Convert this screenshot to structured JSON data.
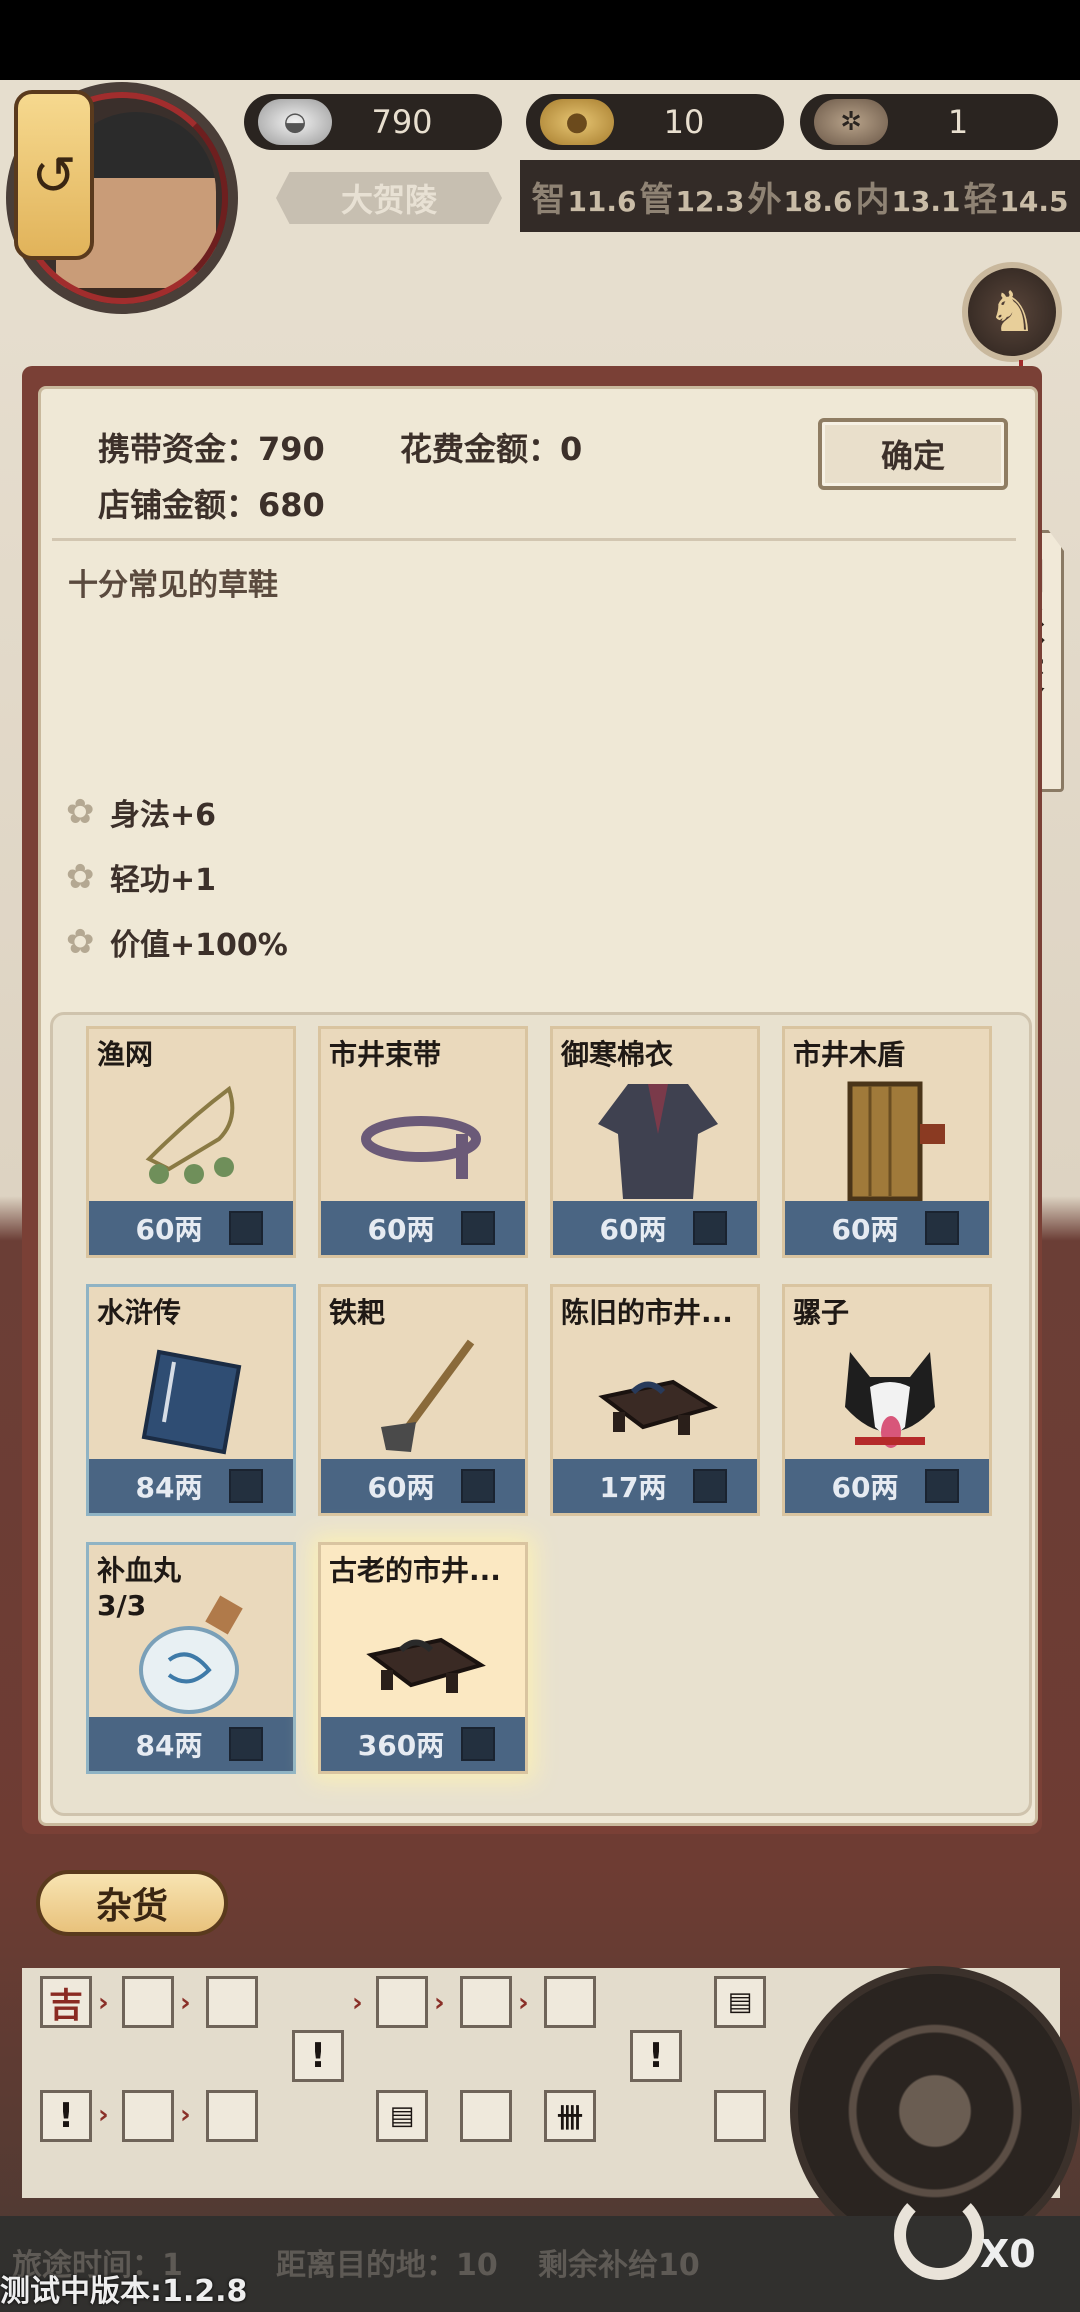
{
  "resources": {
    "silver": "790",
    "coins": "10",
    "wheel": "1"
  },
  "location": "大贺陵",
  "attributes": [
    {
      "icon": "智",
      "value": "11.6"
    },
    {
      "icon": "管",
      "value": "12.3"
    },
    {
      "icon": "外",
      "value": "18.6"
    },
    {
      "icon": "内",
      "value": "13.1"
    },
    {
      "icon": "轻",
      "value": "14.5"
    }
  ],
  "side_tag": [
    "门",
    "派",
    "交",
    "易"
  ],
  "trade": {
    "carry_funds": "携带资金：790",
    "spend_amount": "花费金额：0",
    "shop_amount": "店铺金额：680",
    "confirm_label": "确定",
    "description": "十分常见的草鞋",
    "stats": [
      "身法+6",
      "轻功+1",
      "价值+100%"
    ]
  },
  "items": [
    {
      "name": "渔网",
      "price": "60两",
      "icon": "fishing-net-icon"
    },
    {
      "name": "市井束带",
      "price": "60两",
      "icon": "belt-icon"
    },
    {
      "name": "御寒棉衣",
      "price": "60两",
      "icon": "cotton-coat-icon"
    },
    {
      "name": "市井木盾",
      "price": "60两",
      "icon": "wooden-shield-icon"
    },
    {
      "name": "水浒传",
      "price": "84两",
      "icon": "book-icon"
    },
    {
      "name": "铁耙",
      "price": "60两",
      "icon": "rake-icon"
    },
    {
      "name": "陈旧的市井...",
      "price": "17两",
      "icon": "sandals-icon"
    },
    {
      "name": "骡子",
      "price": "60两",
      "icon": "husky-icon"
    },
    {
      "name": "补血丸",
      "sub": "3/3",
      "price": "84两",
      "icon": "medicine-bottle-icon"
    },
    {
      "name": "古老的市井...",
      "price": "360两",
      "icon": "sandals-icon"
    }
  ],
  "goods_button": "杂货",
  "bottom": {
    "travel_time": "旅途时间：1",
    "distance": "距离目的地：10",
    "supplies": "剩余补给10",
    "version": "测试中版本:1.2.8",
    "multiplier": "X0"
  },
  "colors": {
    "panel_frame": "#7a4036",
    "price_bar": "#4a6583",
    "accent_red": "#a02b2b"
  }
}
